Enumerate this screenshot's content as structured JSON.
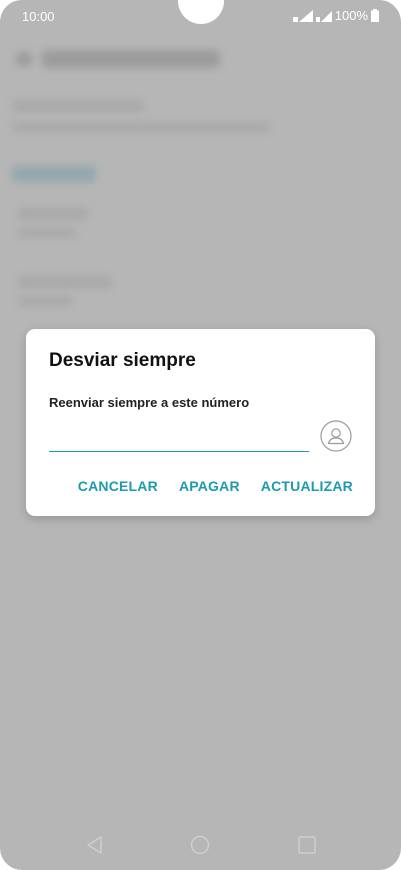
{
  "status_bar": {
    "time": "10:00",
    "battery": "100%",
    "icons": [
      "wifi-icon",
      "signal-icon",
      "battery-icon"
    ]
  },
  "dialog": {
    "title": "Desviar siempre",
    "label": "Reenviar siempre a este número",
    "input_value": "",
    "contact_icon": "contact-icon",
    "actions": {
      "cancel": "CANCELAR",
      "off": "APAGAR",
      "update": "ACTUALIZAR"
    }
  },
  "nav_bar": {
    "icons": [
      "back-icon",
      "home-icon",
      "recents-icon"
    ]
  },
  "colors": {
    "accent": "#1e9ab0",
    "scrim": "#b6b6b6",
    "dialog_bg": "#ffffff"
  }
}
